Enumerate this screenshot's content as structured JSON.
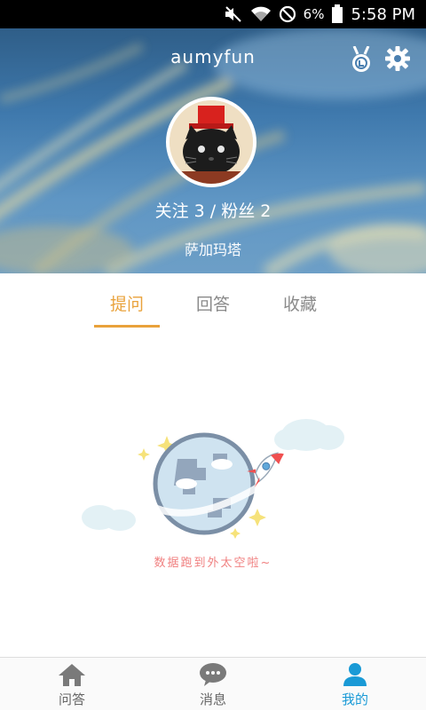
{
  "status_bar": {
    "battery_percent": "6%",
    "time": "5:58 PM",
    "icons": [
      "mute-icon",
      "wifi-icon",
      "blocked-icon",
      "battery-icon"
    ]
  },
  "profile": {
    "username": "aumyfun",
    "follow_stats": "关注 3 / 粉丝 2",
    "location": "萨加玛塔",
    "icons": [
      "medal-icon",
      "gear-icon"
    ]
  },
  "tabs": [
    {
      "label": "提问",
      "active": true
    },
    {
      "label": "回答",
      "active": false
    },
    {
      "label": "收藏",
      "active": false
    }
  ],
  "empty_state": {
    "message": "数据跑到外太空啦~",
    "icon": "planet-rocket-illustration"
  },
  "bottom_nav": [
    {
      "label": "问答",
      "icon": "home-icon",
      "active": false
    },
    {
      "label": "消息",
      "icon": "chat-bubble-icon",
      "active": false
    },
    {
      "label": "我的",
      "icon": "person-icon",
      "active": true
    }
  ],
  "colors": {
    "accent": "#e9a23b",
    "nav_active": "#1a9ad6",
    "empty_text": "#f08080"
  }
}
